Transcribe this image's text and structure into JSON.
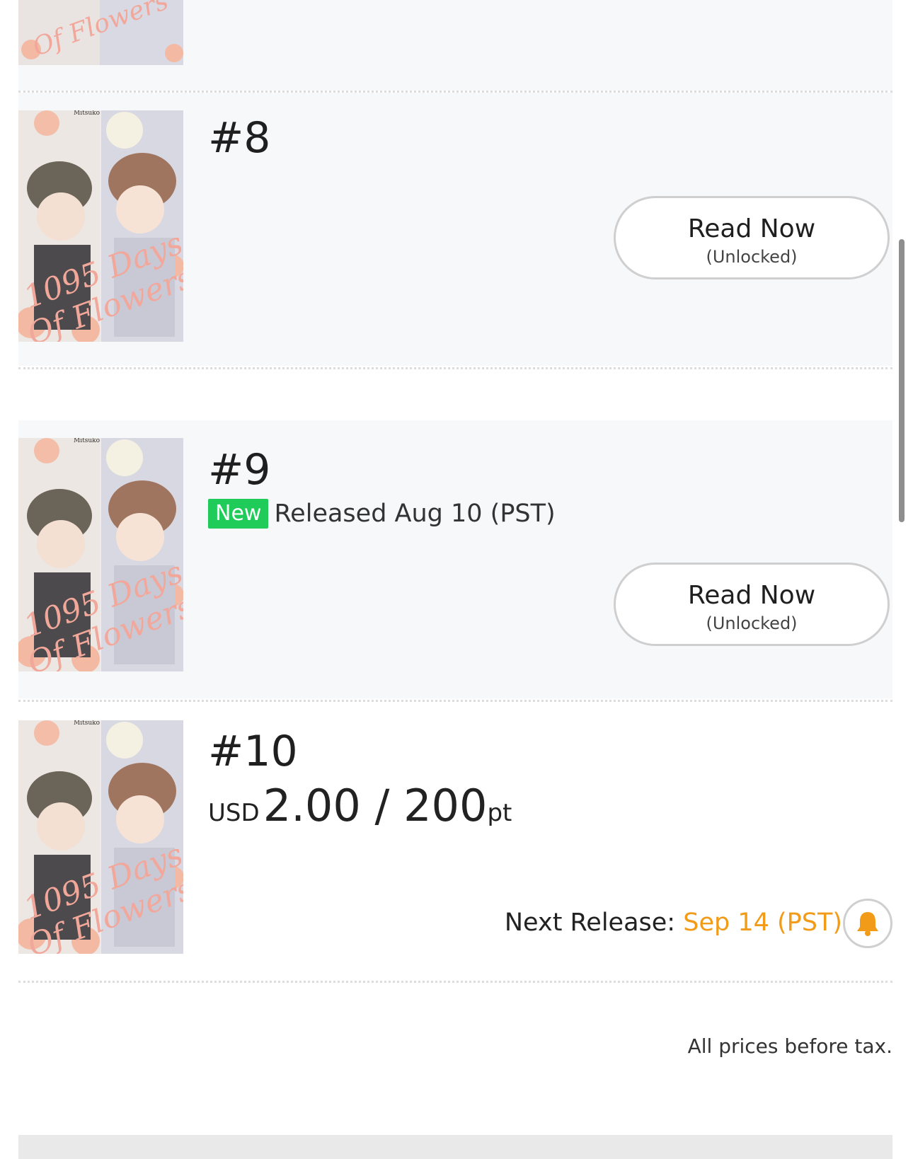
{
  "cover": {
    "author": "Mitsuko",
    "title_line1": "1095 Days",
    "title_line2": "Of Flowers",
    "title_color": "#f2a79b"
  },
  "episodes": [
    {
      "number": "#8",
      "read_button": {
        "main": "Read Now",
        "sub": "(Unlocked)"
      }
    },
    {
      "number": "#9",
      "badge": "New",
      "release_text": "Released Aug 10 (PST)",
      "read_button": {
        "main": "Read Now",
        "sub": "(Unlocked)"
      }
    },
    {
      "number": "#10",
      "price": {
        "currency": "USD",
        "amount": "2.00 / 200",
        "unit": "pt"
      },
      "next_release": {
        "label": "Next Release:",
        "date": "Sep 14 (PST)"
      }
    }
  ],
  "footer": {
    "tax_note": "All prices before tax."
  },
  "colors": {
    "new_badge": "#1fcc5a",
    "release_date": "#f29b18",
    "bell": "#f29b18"
  },
  "icons": {
    "notify": "bell-icon"
  }
}
